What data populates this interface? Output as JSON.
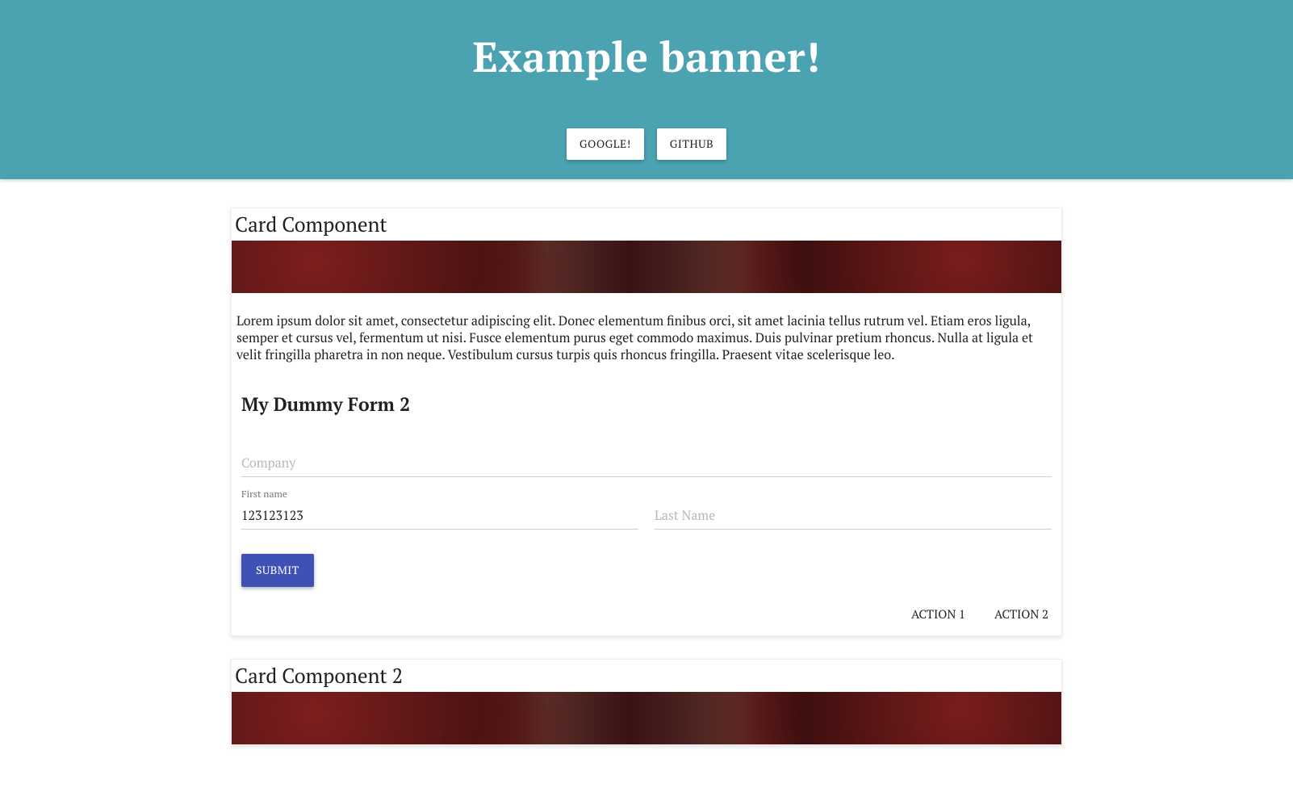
{
  "banner": {
    "title": "Example banner!",
    "buttons": {
      "google": "GOOGLE!",
      "github": "GITHUB"
    }
  },
  "card1": {
    "title": "Card Component",
    "body": "Lorem ipsum dolor sit amet, consectetur adipiscing elit. Donec elementum finibus orci, sit amet lacinia tellus rutrum vel. Etiam eros ligula, semper et cursus vel, fermentum ut nisi. Fusce elementum purus eget commodo maximus. Duis pulvinar pretium rhoncus. Nulla at ligula et velit fringilla pharetra in non neque. Vestibulum cursus turpis quis rhoncus fringilla. Praesent vitae scelerisque leo.",
    "form": {
      "title": "My Dummy Form 2",
      "company": {
        "placeholder": "Company",
        "value": ""
      },
      "first_name": {
        "label": "First name",
        "value": "123123123"
      },
      "last_name": {
        "placeholder": "Last Name",
        "value": ""
      },
      "submit_label": "SUBMIT"
    },
    "actions": {
      "action1": "ACTION 1",
      "action2": "ACTION 2"
    }
  },
  "card2": {
    "title": "Card Component 2"
  }
}
